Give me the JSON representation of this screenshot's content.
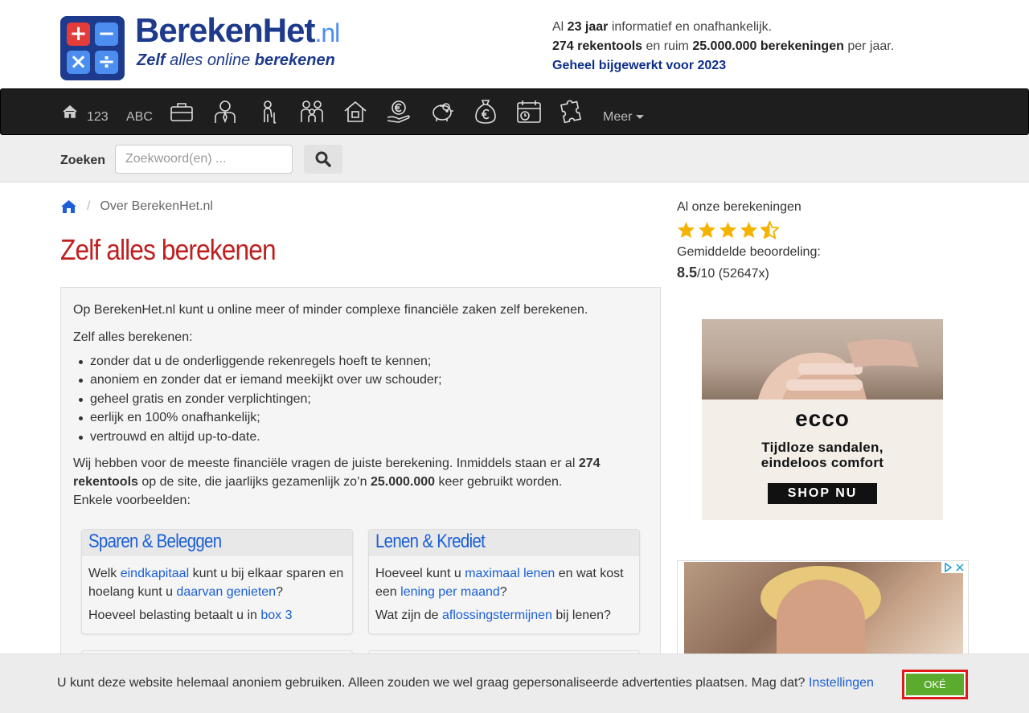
{
  "header": {
    "brand_main": "BerekenHet",
    "brand_tld": ".nl",
    "tagline_1": "Zelf",
    "tagline_2": " alles ",
    "tagline_3": "online",
    "tagline_4": " berekenen",
    "info_line1_pre": "Al ",
    "info_line1_bold": "23 jaar",
    "info_line1_post": " informatief en onafhankelijk.",
    "info_line2_bold1": "274 rekentools",
    "info_line2_mid": " en ruim ",
    "info_line2_bold2": "25.000.000 berekeningen",
    "info_line2_post": " per jaar.",
    "info_line3": "Geheel bijgewerkt voor 2023"
  },
  "nav": {
    "items_text": [
      "123",
      "ABC"
    ],
    "more_label": "Meer",
    "icons": [
      "home-icon",
      "briefcase-icon",
      "business-person-icon",
      "elderly-person-icon",
      "family-icon",
      "house-icon",
      "hand-euro-icon",
      "piggy-bank-icon",
      "money-bag-icon",
      "calendar-icon",
      "puzzle-icon"
    ]
  },
  "search": {
    "label": "Zoeken",
    "placeholder": "Zoekwoord(en) ..."
  },
  "breadcrumb": {
    "current": "Over BerekenHet.nl"
  },
  "main": {
    "title": "Zelf alles berekenen",
    "intro": "Op BerekenHet.nl kunt u online meer of minder complexe financiële zaken zelf berekenen.",
    "subhead": "Zelf alles berekenen:",
    "bullets": [
      "zonder dat u de onderliggende rekenregels hoeft te kennen;",
      "anoniem en zonder dat er iemand meekijkt over uw schouder;",
      "geheel gratis en zonder verplichtingen;",
      "eerlijk en 100% onafhankelijk;",
      "vertrouwd en altijd up-to-date."
    ],
    "para_pre": "Wij hebben voor de meeste financiële vragen de juiste berekening. Inmiddels staan er al ",
    "para_bold1": "274 rekentools",
    "para_mid": " op de site, die jaarlijks gezamenlijk zo’n ",
    "para_bold2": "25.000.000",
    "para_post": " keer gebruikt worden.",
    "examples": "Enkele voorbeelden:"
  },
  "cards": [
    {
      "title": "Sparen & Beleggen",
      "q1_a": "Welk ",
      "q1_link1": "eindkapitaal",
      "q1_b": " kunt u bij elkaar sparen en hoelang kunt u ",
      "q1_link2": "daarvan genieten",
      "q1_c": "?",
      "q2_a": "Hoeveel belasting betaalt u in ",
      "q2_link": "box 3",
      "q2_b": ""
    },
    {
      "title": "Lenen & Krediet",
      "q1_a": "Hoeveel kunt u ",
      "q1_link1": "maximaal lenen",
      "q1_b": " en wat kost een ",
      "q1_link2": "lening per maand",
      "q1_c": "?",
      "q2_a": "Wat zijn de ",
      "q2_link": "aflossingstermijnen",
      "q2_b": " bij lenen?"
    }
  ],
  "sidebar": {
    "title": "Al onze berekeningen",
    "rating_stars": 4.5,
    "avg_label": "Gemiddelde beoordeling:",
    "score": "8.5",
    "score_rest": "/10 (52647x)"
  },
  "ad1": {
    "brand": "ecco",
    "text_line1": "Tijdloze sandalen,",
    "text_line2": "eindeloos comfort",
    "button": "SHOP NU"
  },
  "cookie": {
    "text": "U kunt deze website helemaal anoniem gebruiken. Alleen zouden we wel graag gepersonaliseerde advertenties plaatsen. Mag dat?",
    "settings": "Instellingen",
    "ok": "OKÉ"
  },
  "colors": {
    "brand_blue": "#1d3a8c",
    "title_red": "#c01f1f",
    "link_blue": "#1a5fd6",
    "ok_green": "#5aab2e",
    "star_gold": "#f5b301"
  }
}
